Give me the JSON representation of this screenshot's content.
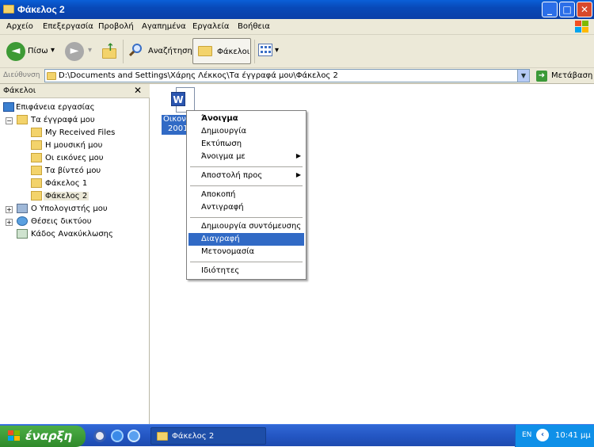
{
  "window": {
    "title": "Φάκελος 2",
    "minimize_glyph": "_",
    "maximize_glyph": "□",
    "close_glyph": "✕"
  },
  "menubar": {
    "items": [
      "Αρχείο",
      "Επεξεργασία",
      "Προβολή",
      "Αγαπημένα",
      "Εργαλεία",
      "Βοήθεια"
    ]
  },
  "toolbar": {
    "back_label": "Πίσω",
    "search_label": "Αναζήτηση",
    "folders_label": "Φάκελοι",
    "back_arrow": "◄",
    "forward_arrow": "►",
    "dropdown_glyph": "▾"
  },
  "address": {
    "label": "Διεύθυνση",
    "path": "D:\\Documents and Settings\\Χάρης Λέκκος\\Τα έγγραφά μου\\Φάκελος 2",
    "dropdown_glyph": "▼",
    "go_label": "Μετάβαση",
    "go_arrow": "➜"
  },
  "folders_pane": {
    "title": "Φάκελοι",
    "close_glyph": "✕",
    "expand_minus": "−",
    "expand_plus": "+",
    "tree": {
      "desktop": "Επιφάνεια εργασίας",
      "my_documents": "Τα έγγραφά μου",
      "received_files": "My Received Files",
      "my_music": "Η μουσική μου",
      "my_pictures": "Οι εικόνες μου",
      "my_videos": "Τα βίντεό μου",
      "folder1": "Φάκελος 1",
      "folder2": "Φάκελος 2",
      "my_computer": "Ο Υπολογιστής μου",
      "network": "Θέσεις δικτύου",
      "recycle_bin": "Κάδος Ανακύκλωσης"
    }
  },
  "file": {
    "name_line1": "Οικονο",
    "name_line2": "2001.d",
    "icon_letter": "W"
  },
  "context_menu": {
    "open": "Άνοιγμα",
    "new": "Δημιουργία",
    "print": "Εκτύπωση",
    "open_with": "Άνοιγμα με",
    "send_to": "Αποστολή προς",
    "cut": "Αποκοπή",
    "copy": "Αντιγραφή",
    "create_shortcut": "Δημιουργία συντόμευσης",
    "delete": "Διαγραφή",
    "rename": "Μετονομασία",
    "properties": "Ιδιότητες",
    "submenu_arrow": "▶"
  },
  "taskbar": {
    "start_label": "έναρξη",
    "task_label": "Φάκελος 2",
    "lang": "EN",
    "tray_chevron": "‹",
    "clock": "10:41 μμ"
  },
  "colors": {
    "title_blue": "#0a5fd8",
    "selection_blue": "#316ac5",
    "start_green": "#3a9a35",
    "tray_blue": "#0f90e8"
  }
}
